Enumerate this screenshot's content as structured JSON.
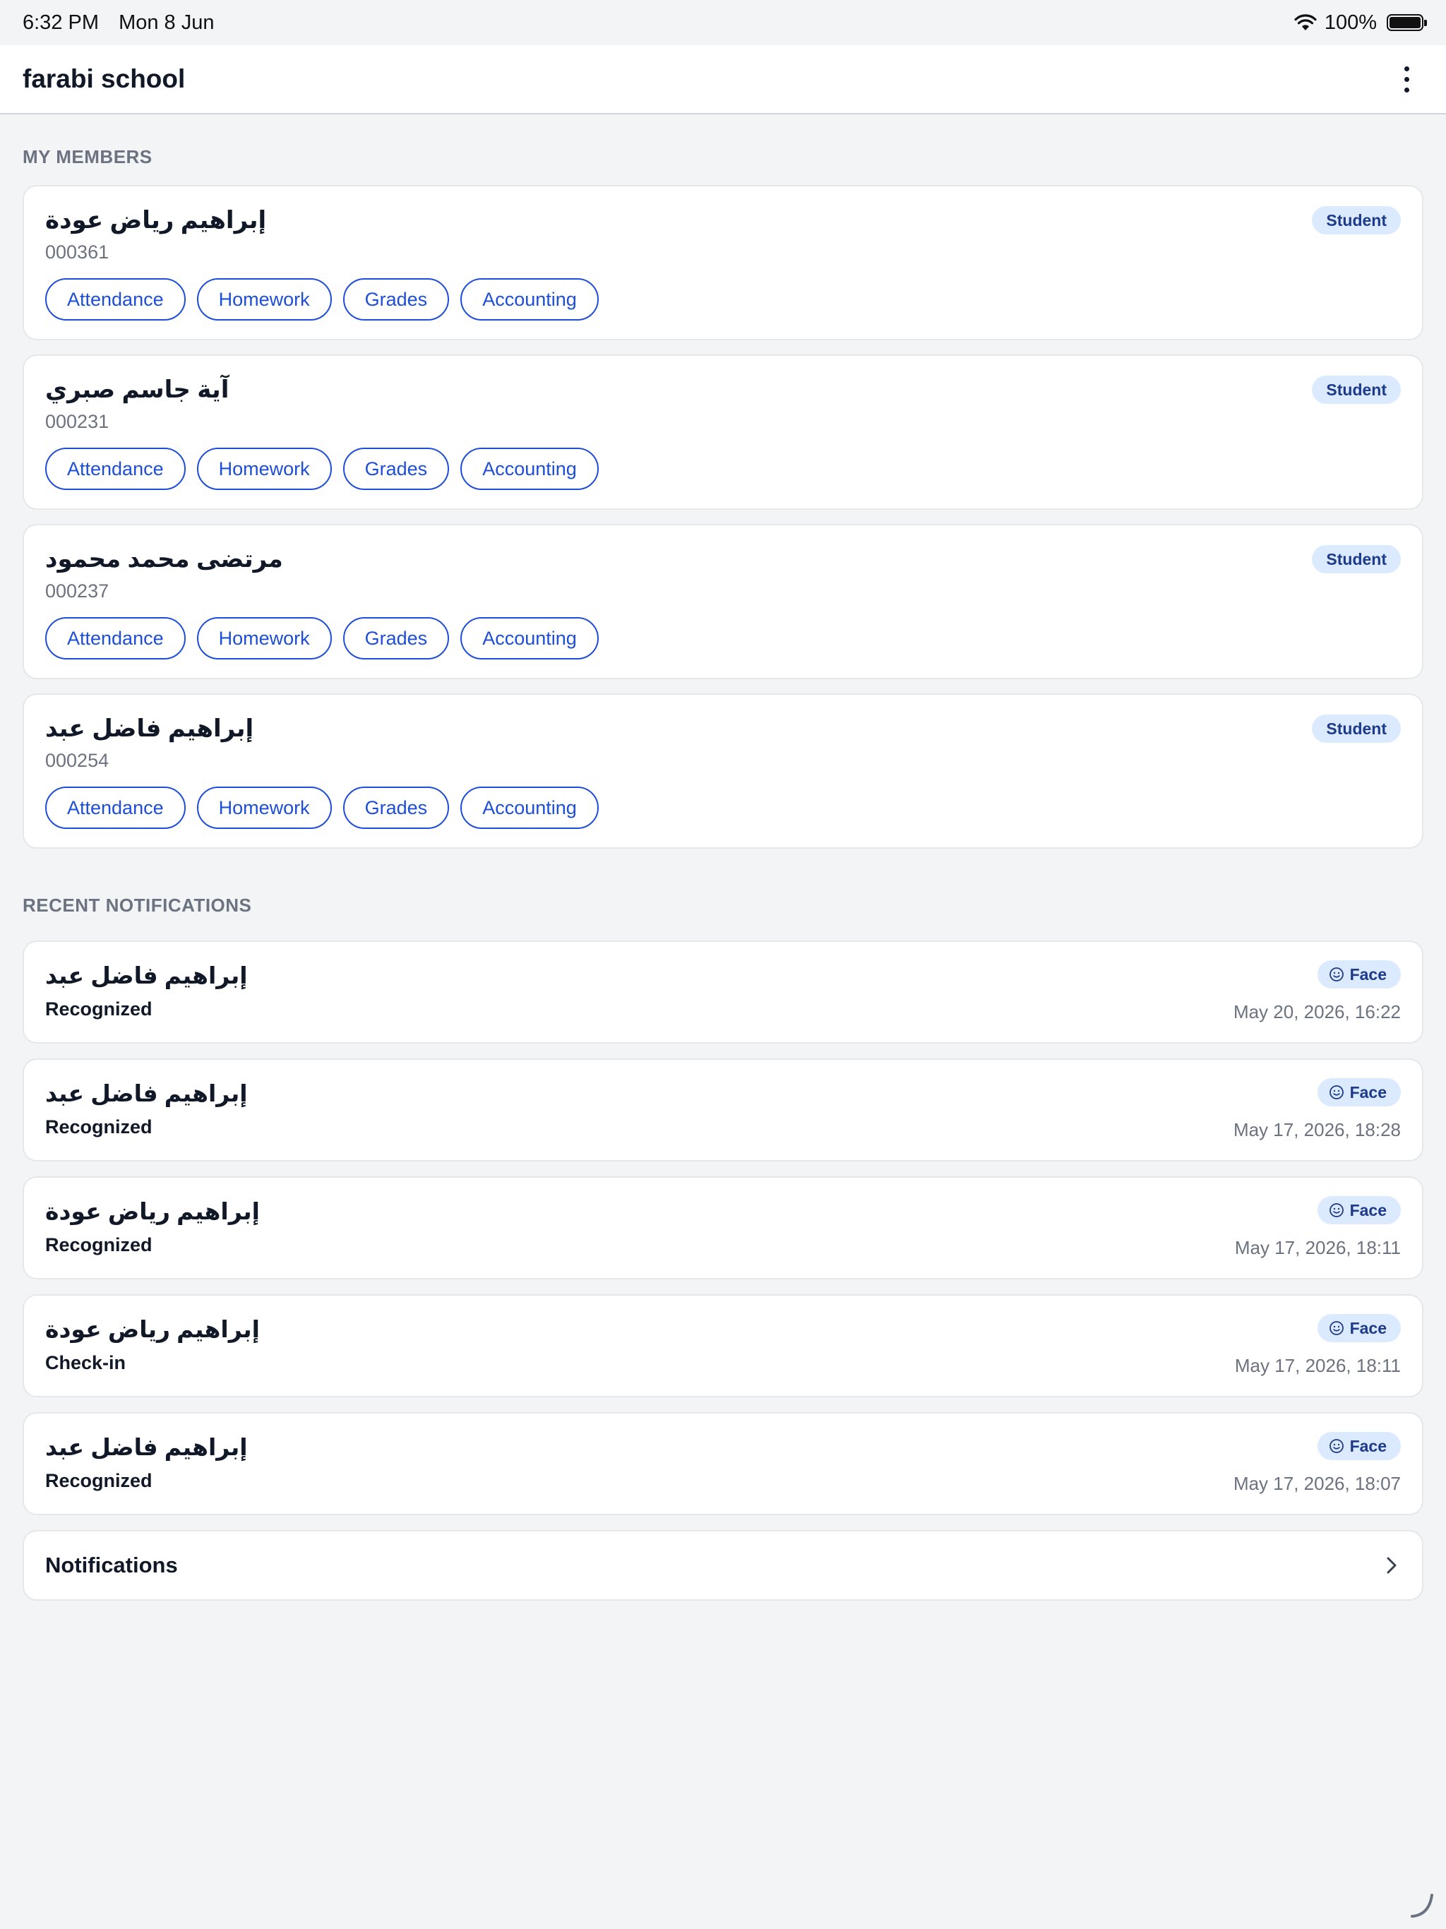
{
  "status_bar": {
    "time": "6:32 PM",
    "date": "Mon 8 Jun",
    "battery": "100%"
  },
  "header": {
    "title": "farabi school",
    "menu_icon": "more-vertical-icon"
  },
  "members_section": {
    "title": "MY MEMBERS",
    "members": [
      {
        "name": "إبراهيم رياض عودة",
        "id": "000361",
        "role": "Student"
      },
      {
        "name": "آية جاسم صبري",
        "id": "000231",
        "role": "Student"
      },
      {
        "name": "مرتضى محمد محمود",
        "id": "000237",
        "role": "Student"
      },
      {
        "name": "إبراهيم فاضل عبد",
        "id": "000254",
        "role": "Student"
      }
    ],
    "actions": {
      "attendance": "Attendance",
      "homework": "Homework",
      "grades": "Grades",
      "accounting": "Accounting"
    }
  },
  "notifications_section": {
    "title": "RECENT NOTIFICATIONS",
    "items": [
      {
        "name": "إبراهيم فاضل عبد",
        "event": "Recognized",
        "badge": "Face",
        "time": "May 20, 2026, 16:22"
      },
      {
        "name": "إبراهيم فاضل عبد",
        "event": "Recognized",
        "badge": "Face",
        "time": "May 17, 2026, 18:28"
      },
      {
        "name": "إبراهيم رياض عودة",
        "event": "Recognized",
        "badge": "Face",
        "time": "May 17, 2026, 18:11"
      },
      {
        "name": "إبراهيم رياض عودة",
        "event": "Check-in",
        "badge": "Face",
        "time": "May 17, 2026, 18:11"
      },
      {
        "name": "إبراهيم فاضل عبد",
        "event": "Recognized",
        "badge": "Face",
        "time": "May 17, 2026, 18:07"
      }
    ],
    "link_label": "Notifications"
  },
  "colors": {
    "accent": "#1d4ed8",
    "badge_bg": "#dbeafe",
    "badge_text": "#1e3a8a",
    "background": "#f3f4f6"
  }
}
